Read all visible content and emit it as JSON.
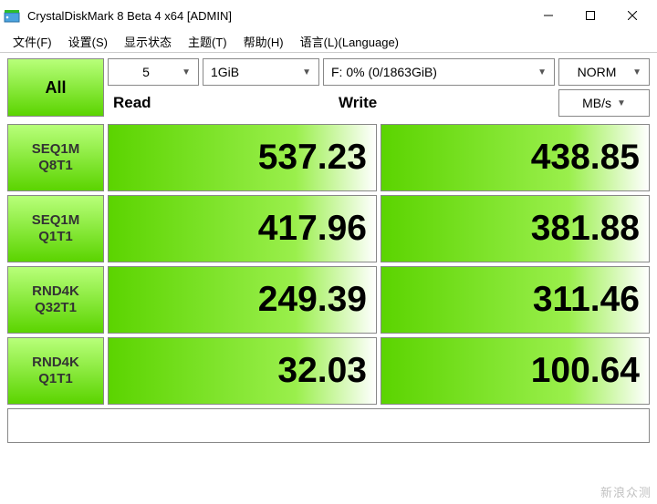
{
  "window": {
    "title": "CrystalDiskMark 8 Beta 4 x64 [ADMIN]"
  },
  "menu": {
    "file": "文件(F)",
    "settings": "设置(S)",
    "display": "显示状态",
    "theme": "主题(T)",
    "help": "帮助(H)",
    "language": "语言(L)(Language)"
  },
  "controls": {
    "all_label": "All",
    "runs": "5",
    "size": "1GiB",
    "drive": "F: 0% (0/1863GiB)",
    "mode": "NORM",
    "unit": "MB/s"
  },
  "headers": {
    "read": "Read",
    "write": "Write"
  },
  "tests": [
    {
      "label1": "SEQ1M",
      "label2": "Q8T1",
      "read": "537.23",
      "write": "438.85"
    },
    {
      "label1": "SEQ1M",
      "label2": "Q1T1",
      "read": "417.96",
      "write": "381.88"
    },
    {
      "label1": "RND4K",
      "label2": "Q32T1",
      "read": "249.39",
      "write": "311.46"
    },
    {
      "label1": "RND4K",
      "label2": "Q1T1",
      "read": "32.03",
      "write": "100.64"
    }
  ],
  "watermark": "新浪众测"
}
